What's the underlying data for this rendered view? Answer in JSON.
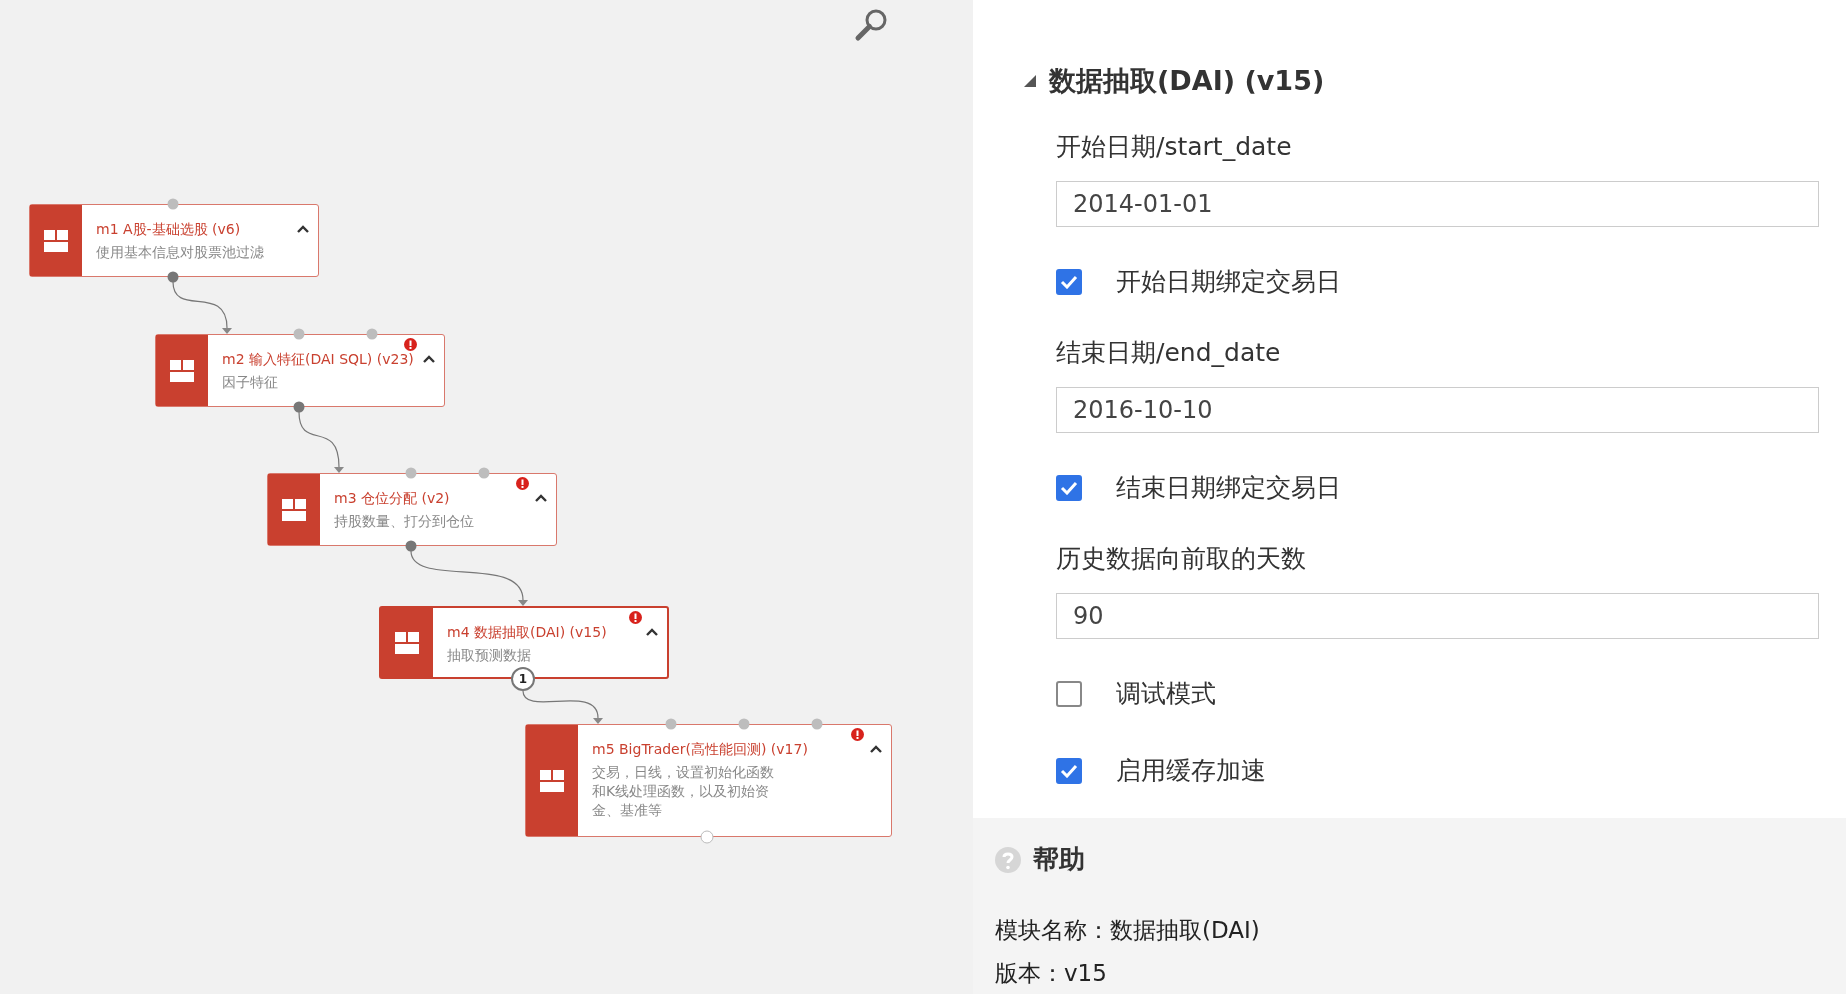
{
  "canvas": {
    "nodes": [
      {
        "title": "m1 A股-基础选股 (v6)",
        "description": "使用基本信息对股票池过滤",
        "selected": false,
        "warning": false
      },
      {
        "title": "m2 输入特征(DAI SQL) (v23)",
        "description": "因子特征",
        "selected": false,
        "warning": true
      },
      {
        "title": "m3 仓位分配 (v2)",
        "description": "持股数量、打分到仓位",
        "selected": false,
        "warning": true
      },
      {
        "title": "m4 数据抽取(DAI) (v15)",
        "description": "抽取预测数据",
        "selected": true,
        "warning": true,
        "output_badge": "1"
      },
      {
        "title": "m5 BigTrader(高性能回测) (v17)",
        "description": "交易，日线，设置初始化函数和K线处理函数，以及初始资金、基准等",
        "selected": false,
        "warning": true
      }
    ]
  },
  "properties": {
    "title": "数据抽取(DAI) (v15)",
    "expanded": true,
    "params": [
      {
        "kind": "text",
        "label": "开始日期/start_date",
        "value": "2014-01-01"
      },
      {
        "kind": "checkbox",
        "label": "开始日期绑定交易日",
        "checked": true
      },
      {
        "kind": "text",
        "label": "结束日期/end_date",
        "value": "2016-10-10"
      },
      {
        "kind": "checkbox",
        "label": "结束日期绑定交易日",
        "checked": true
      },
      {
        "kind": "text",
        "label": "历史数据向前取的天数",
        "value": "90"
      },
      {
        "kind": "checkbox",
        "label": "调试模式",
        "checked": false
      },
      {
        "kind": "checkbox",
        "label": "启用缓存加速",
        "checked": true
      }
    ]
  },
  "help": {
    "title": "帮助",
    "lines": [
      "模块名称：数据抽取(DAI)",
      "版本：v15"
    ]
  }
}
